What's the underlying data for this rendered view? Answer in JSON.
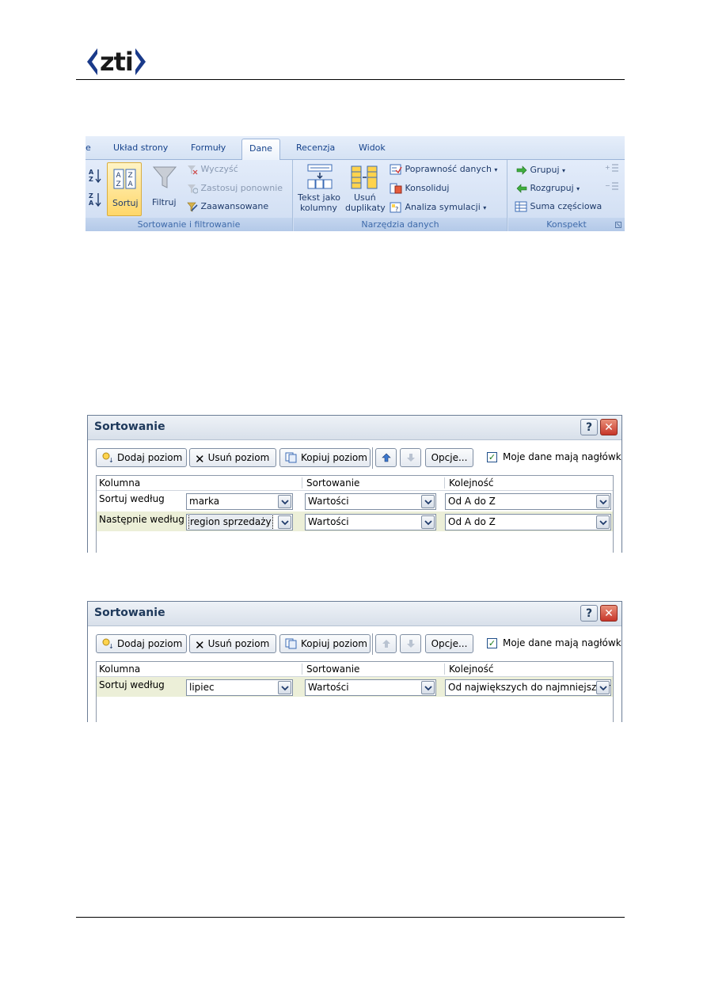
{
  "header": {
    "logo_text": "zti"
  },
  "ribbon": {
    "tabs": [
      "e",
      "Układ strony",
      "Formuły",
      "Dane",
      "Recenzja",
      "Widok"
    ],
    "active_tab": "Dane",
    "sort_filter": {
      "sort_label": "Sortuj",
      "filter_label": "Filtruj",
      "clear_label": "Wyczyść",
      "reapply_label": "Zastosuj ponownie",
      "advanced_label": "Zaawansowane",
      "caption": "Sortowanie i filtrowanie"
    },
    "data_tools": {
      "text_to_columns_line1": "Tekst jako",
      "text_to_columns_line2": "kolumny",
      "remove_dup_line1": "Usuń",
      "remove_dup_line2": "duplikaty",
      "validation_label": "Poprawność danych",
      "consolidate_label": "Konsoliduj",
      "whatif_label": "Analiza symulacji",
      "caption": "Narzędzia danych"
    },
    "outline": {
      "group_label": "Grupuj",
      "ungroup_label": "Rozgrupuj",
      "subtotal_label": "Suma częściowa",
      "caption": "Konspekt"
    }
  },
  "dialog1": {
    "title": "Sortowanie",
    "add_level": "Dodaj poziom",
    "delete_level": "Usuń poziom",
    "copy_level": "Kopiuj poziom",
    "options": "Opcje...",
    "headers_checkbox_label": "Moje dane mają nagłówki",
    "headers_checked": true,
    "col_header_column": "Kolumna",
    "col_header_sort_on": "Sortowanie",
    "col_header_order": "Kolejność",
    "rows": [
      {
        "label": "Sortuj według",
        "column": "marka",
        "sort_on": "Wartości",
        "order": "Od A do Z"
      },
      {
        "label": "Następnie według",
        "column": "region sprzedaży",
        "sort_on": "Wartości",
        "order": "Od A do Z"
      }
    ]
  },
  "dialog2": {
    "title": "Sortowanie",
    "add_level": "Dodaj poziom",
    "delete_level": "Usuń poziom",
    "copy_level": "Kopiuj poziom",
    "options": "Opcje...",
    "headers_checkbox_label": "Moje dane mają nagłówki",
    "headers_checked": true,
    "col_header_column": "Kolumna",
    "col_header_sort_on": "Sortowanie",
    "col_header_order": "Kolejność",
    "rows": [
      {
        "label": "Sortuj według",
        "column": "lipiec",
        "sort_on": "Wartości",
        "order": "Od największych do najmniejszych"
      }
    ]
  },
  "colors": {
    "ribbon_text": "#15428b",
    "selected_row": "#ecefd8",
    "close_button": "#c7362a"
  }
}
